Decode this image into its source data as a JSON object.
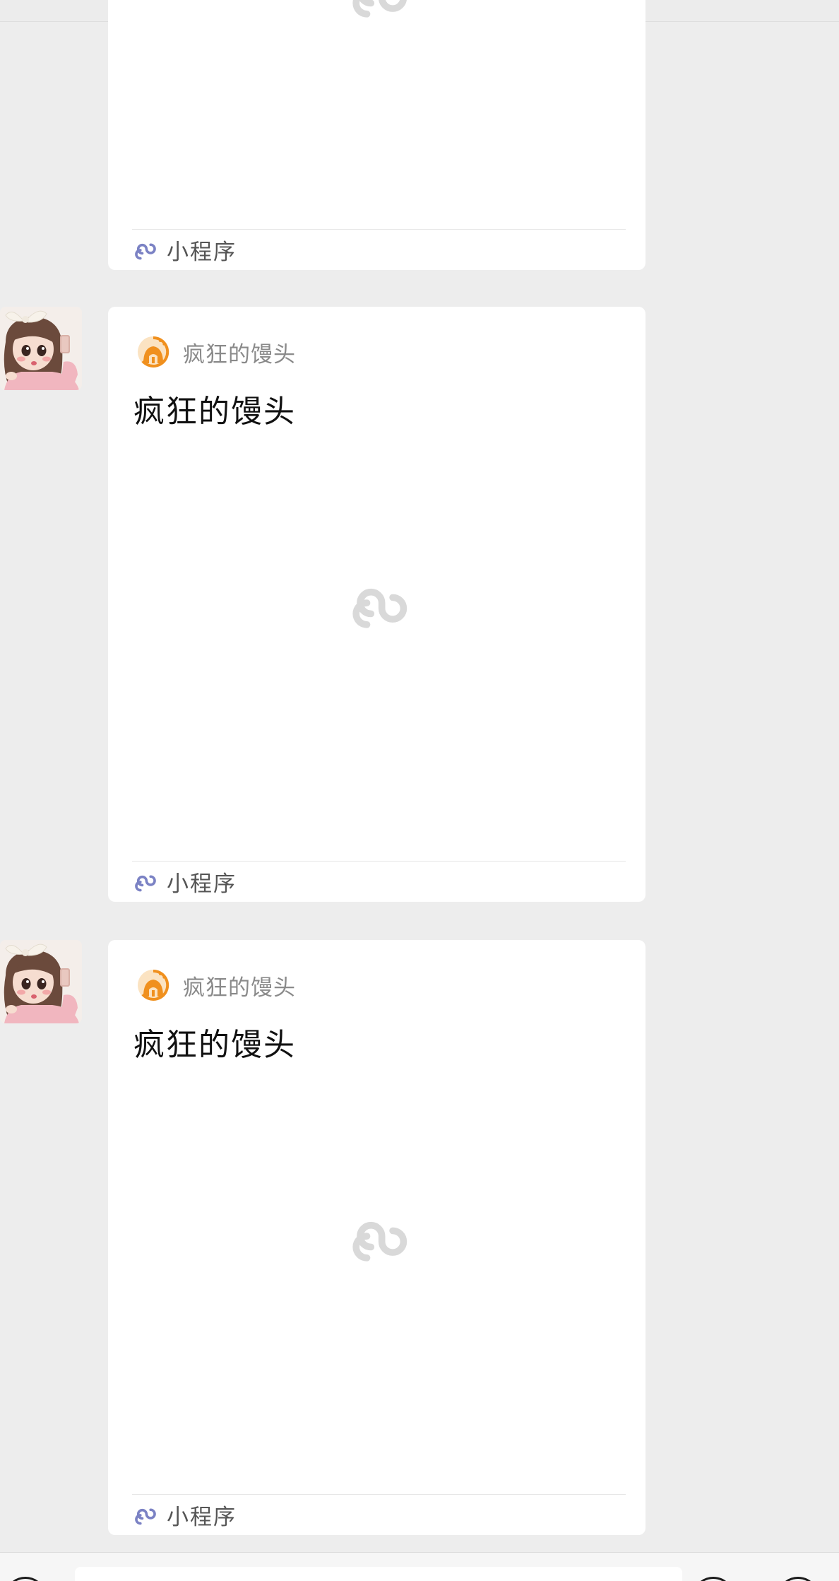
{
  "messages": [
    {
      "has_header": false,
      "app_name": "",
      "title": "",
      "footer_label": "小程序"
    },
    {
      "has_header": true,
      "app_name": "疯狂的馒头",
      "title": "疯狂的馒头",
      "footer_label": "小程序"
    },
    {
      "has_header": true,
      "app_name": "疯狂的馒头",
      "title": "疯狂的馒头",
      "footer_label": "小程序"
    }
  ],
  "colors": {
    "background": "#ededed",
    "card": "#ffffff",
    "miniprogram_icon": "#7b82c4",
    "app_logo": "#f0901e",
    "placeholder_icon": "#d9d9d9"
  },
  "icons": {
    "placeholder": "miniprogram-link-icon",
    "footer": "miniprogram-icon",
    "app_logo": "crazy-mantou-logo-icon"
  }
}
